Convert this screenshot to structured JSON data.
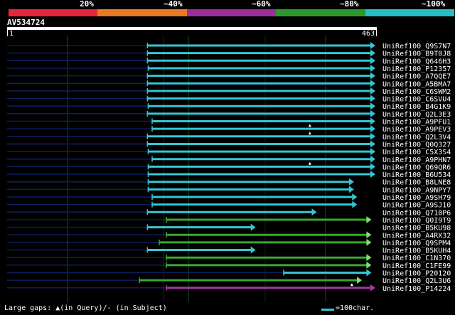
{
  "scale": {
    "labels": [
      "20%",
      "~40%",
      "~60%",
      "~80%",
      "~100%"
    ],
    "colors": [
      "#e8263b",
      "#e87b24",
      "#9d2e9e",
      "#2b9a2b",
      "#2abdc5"
    ]
  },
  "query": {
    "title": "AV534724",
    "start": "1",
    "end": "463",
    "length": 463
  },
  "colors": {
    "background": "#000000",
    "hit_100": "#34c6d3",
    "hit_80": "#3aa82e",
    "hit_60": "#a237a2",
    "arrow_green": "#7be36a",
    "grid": "#1e4a1e",
    "left_line": "#0e1f5e"
  },
  "hits": [
    {
      "name": "UniRef100_Q9S7N7",
      "start": 178,
      "end": 463,
      "identity": "100"
    },
    {
      "name": "UniRef100_B9T0J8",
      "start": 178,
      "end": 463,
      "identity": "100"
    },
    {
      "name": "UniRef100_Q646H3",
      "start": 178,
      "end": 463,
      "identity": "100"
    },
    {
      "name": "UniRef100_P12357",
      "start": 179,
      "end": 463,
      "identity": "100"
    },
    {
      "name": "UniRef100_A7QQE7",
      "start": 178,
      "end": 463,
      "identity": "100"
    },
    {
      "name": "UniRef100_A5BMA7",
      "start": 178,
      "end": 463,
      "identity": "100"
    },
    {
      "name": "UniRef100_C6SWM2",
      "start": 178,
      "end": 463,
      "identity": "100"
    },
    {
      "name": "UniRef100_C6SVU4",
      "start": 178,
      "end": 463,
      "identity": "100"
    },
    {
      "name": "UniRef100_B4G1K9",
      "start": 179,
      "end": 463,
      "identity": "100"
    },
    {
      "name": "UniRef100_Q2L3E3",
      "start": 178,
      "end": 463,
      "identity": "100"
    },
    {
      "name": "UniRef100_A9PFU1",
      "start": 184,
      "end": 463,
      "identity": "100",
      "gap_at": 383
    },
    {
      "name": "UniRef100_A9PEV3",
      "start": 184,
      "end": 463,
      "identity": "100",
      "gap_at": 383
    },
    {
      "name": "UniRef100_Q2L3V4",
      "start": 178,
      "end": 463,
      "identity": "100"
    },
    {
      "name": "UniRef100_Q0Q327",
      "start": 178,
      "end": 463,
      "identity": "100"
    },
    {
      "name": "UniRef100_C5X3S4",
      "start": 179,
      "end": 463,
      "identity": "100"
    },
    {
      "name": "UniRef100_A9PHN7",
      "start": 184,
      "end": 463,
      "identity": "100",
      "gap_at": 383
    },
    {
      "name": "UniRef100_Q69QR6",
      "start": 179,
      "end": 463,
      "identity": "100"
    },
    {
      "name": "UniRef100_B6U534",
      "start": 179,
      "end": 463,
      "identity": "100"
    },
    {
      "name": "UniRef100_B8LNE8",
      "start": 179,
      "end": 436,
      "identity": "100"
    },
    {
      "name": "UniRef100_A9NPY7",
      "start": 179,
      "end": 436,
      "identity": "100"
    },
    {
      "name": "UniRef100_A9SH79",
      "start": 184,
      "end": 440,
      "identity": "100"
    },
    {
      "name": "UniRef100_A9SJ10",
      "start": 184,
      "end": 440,
      "identity": "100"
    },
    {
      "name": "UniRef100_Q710P6",
      "start": 178,
      "end": 389,
      "identity": "100"
    },
    {
      "name": "UniRef100_Q0I9T9",
      "start": 202,
      "end": 458,
      "identity": "80"
    },
    {
      "name": "UniRef100_B5KU98",
      "start": 178,
      "end": 312,
      "identity": "100"
    },
    {
      "name": "UniRef100_A4RX32",
      "start": 202,
      "end": 458,
      "identity": "80"
    },
    {
      "name": "UniRef100_Q9SPM4",
      "start": 193,
      "end": 458,
      "identity": "80"
    },
    {
      "name": "UniRef100_B5KUH4",
      "start": 178,
      "end": 312,
      "identity": "100"
    },
    {
      "name": "UniRef100_C1N370",
      "start": 202,
      "end": 458,
      "identity": "80"
    },
    {
      "name": "UniRef100_C1FE99",
      "start": 202,
      "end": 458,
      "identity": "80"
    },
    {
      "name": "UniRef100_P20120",
      "start": 350,
      "end": 458,
      "identity": "100"
    },
    {
      "name": "UniRef100_Q2L3U6",
      "start": 168,
      "end": 446,
      "identity": "80",
      "gap_at": 436
    },
    {
      "name": "UniRef100_P14224",
      "start": 202,
      "end": 463,
      "identity": "60"
    }
  ],
  "footer": {
    "gaps_text": "Large gaps: ▲(in Query)/- (in Subject)",
    "legend_text": "=100char."
  }
}
